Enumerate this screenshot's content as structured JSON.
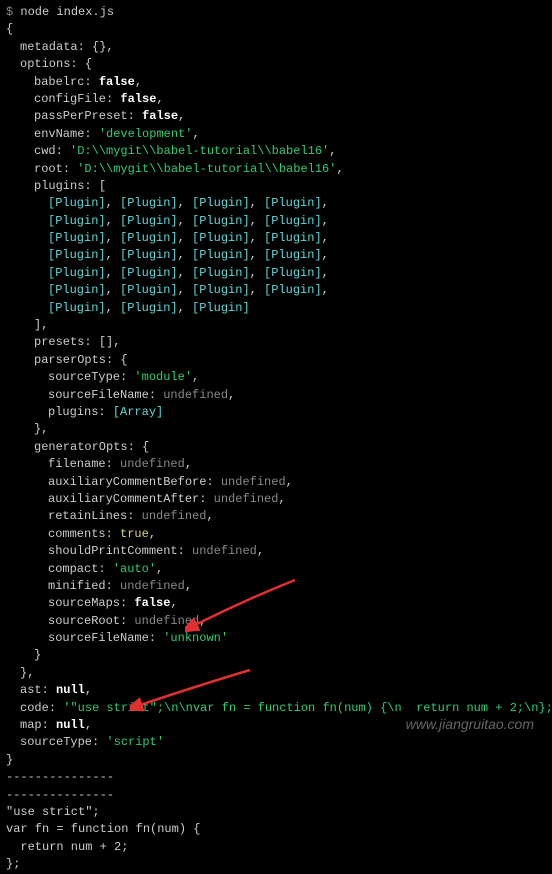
{
  "prompt": "$ ",
  "command": "node index.js",
  "obj": {
    "open": "{",
    "metadata": {
      "key": "metadata",
      "val": "{},"
    },
    "options": {
      "key": "options",
      "open": "{"
    },
    "babelrc": {
      "key": "babelrc",
      "val": "false",
      "comma": ","
    },
    "configFile": {
      "key": "configFile",
      "val": "false",
      "comma": ","
    },
    "passPerPreset": {
      "key": "passPerPreset",
      "val": "false",
      "comma": ","
    },
    "envName": {
      "key": "envName",
      "val": "'development'",
      "comma": ","
    },
    "cwd": {
      "key": "cwd",
      "val": "'D:\\\\mygit\\\\babel-tutorial\\\\babel16'",
      "comma": ","
    },
    "root": {
      "key": "root",
      "val": "'D:\\\\mygit\\\\babel-tutorial\\\\babel16'",
      "comma": ","
    },
    "plugins": {
      "key": "plugins",
      "open": "["
    },
    "plugin_token": "[Plugin]",
    "plugins_close": "],",
    "presets": {
      "key": "presets",
      "val": "[],"
    },
    "parserOpts": {
      "key": "parserOpts",
      "open": "{"
    },
    "sourceType": {
      "key": "sourceType",
      "val": "'module'",
      "comma": ","
    },
    "sourceFileName": {
      "key": "sourceFileName",
      "val": "undefined",
      "comma": ","
    },
    "parserPlugins": {
      "key": "plugins",
      "val": "[Array]"
    },
    "parserOpts_close": "},",
    "generatorOpts": {
      "key": "generatorOpts",
      "open": "{"
    },
    "filename": {
      "key": "filename",
      "val": "undefined",
      "comma": ","
    },
    "auxBefore": {
      "key": "auxiliaryCommentBefore",
      "val": "undefined",
      "comma": ","
    },
    "auxAfter": {
      "key": "auxiliaryCommentAfter",
      "val": "undefined",
      "comma": ","
    },
    "retainLines": {
      "key": "retainLines",
      "val": "undefined",
      "comma": ","
    },
    "comments": {
      "key": "comments",
      "val": "true",
      "comma": ","
    },
    "shouldPrintComment": {
      "key": "shouldPrintComment",
      "val": "undefined",
      "comma": ","
    },
    "compact": {
      "key": "compact",
      "val": "'auto'",
      "comma": ","
    },
    "minified": {
      "key": "minified",
      "val": "undefined",
      "comma": ","
    },
    "sourceMaps": {
      "key": "sourceMaps",
      "val": "false",
      "comma": ","
    },
    "sourceRoot": {
      "key": "sourceRoot",
      "val": "undefined",
      "comma": ","
    },
    "genSourceFileName": {
      "key": "sourceFileName",
      "val": "'unknown'"
    },
    "generatorOpts_close": "}",
    "options_close": "},",
    "ast": {
      "key": "ast",
      "val": "null",
      "comma": ","
    },
    "code": {
      "key": "code",
      "val": "'\"use strict\";\\n\\nvar fn = function fn(num) {\\n  return num + 2;\\n};'",
      "comma": ","
    },
    "map": {
      "key": "map",
      "val": "null",
      "comma": ","
    },
    "sourceTypeOut": {
      "key": "sourceType",
      "val": "'script'"
    },
    "close": "}"
  },
  "divider1": "---------------",
  "divider2": "---------------",
  "output": {
    "line1": "\"use strict\";",
    "line2": "",
    "line3": "var fn = function fn(num) {",
    "line4": "  return num + 2;",
    "line5": "};"
  },
  "watermark": "www.jiangruitao.com"
}
